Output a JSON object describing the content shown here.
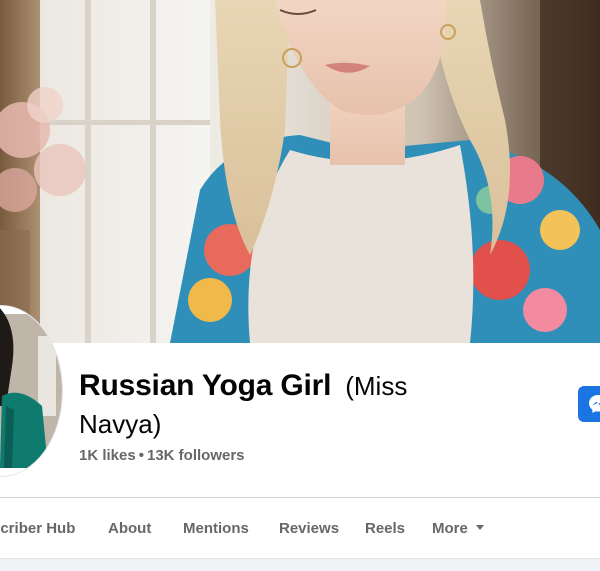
{
  "header": {
    "page_name": "Russian Yoga Girl",
    "alt_name_part1": "(Miss",
    "alt_name_part2": "Navya)",
    "likes": "1K likes",
    "separator": "•",
    "followers": "13K followers"
  },
  "tabs": [
    {
      "label": "scriber Hub"
    },
    {
      "label": "About"
    },
    {
      "label": "Mentions"
    },
    {
      "label": "Reviews"
    },
    {
      "label": "Reels"
    },
    {
      "label": "More"
    }
  ],
  "colors": {
    "accent": "#1b74e4",
    "text_primary": "#050505",
    "text_secondary": "#65676b",
    "divider": "#ced0d4"
  },
  "icons": {
    "messenger": "messenger-icon",
    "more_caret": "caret-down-icon"
  }
}
